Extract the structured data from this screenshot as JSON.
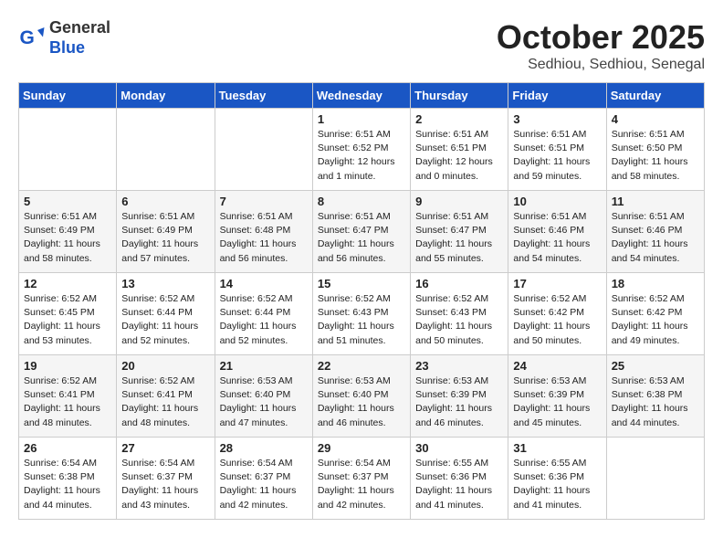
{
  "header": {
    "logo_general": "General",
    "logo_blue": "Blue",
    "month_title": "October 2025",
    "location": "Sedhiou, Sedhiou, Senegal"
  },
  "days_of_week": [
    "Sunday",
    "Monday",
    "Tuesday",
    "Wednesday",
    "Thursday",
    "Friday",
    "Saturday"
  ],
  "weeks": [
    [
      {
        "day": "",
        "info": ""
      },
      {
        "day": "",
        "info": ""
      },
      {
        "day": "",
        "info": ""
      },
      {
        "day": "1",
        "info": "Sunrise: 6:51 AM\nSunset: 6:52 PM\nDaylight: 12 hours\nand 1 minute."
      },
      {
        "day": "2",
        "info": "Sunrise: 6:51 AM\nSunset: 6:51 PM\nDaylight: 12 hours\nand 0 minutes."
      },
      {
        "day": "3",
        "info": "Sunrise: 6:51 AM\nSunset: 6:51 PM\nDaylight: 11 hours\nand 59 minutes."
      },
      {
        "day": "4",
        "info": "Sunrise: 6:51 AM\nSunset: 6:50 PM\nDaylight: 11 hours\nand 58 minutes."
      }
    ],
    [
      {
        "day": "5",
        "info": "Sunrise: 6:51 AM\nSunset: 6:49 PM\nDaylight: 11 hours\nand 58 minutes."
      },
      {
        "day": "6",
        "info": "Sunrise: 6:51 AM\nSunset: 6:49 PM\nDaylight: 11 hours\nand 57 minutes."
      },
      {
        "day": "7",
        "info": "Sunrise: 6:51 AM\nSunset: 6:48 PM\nDaylight: 11 hours\nand 56 minutes."
      },
      {
        "day": "8",
        "info": "Sunrise: 6:51 AM\nSunset: 6:47 PM\nDaylight: 11 hours\nand 56 minutes."
      },
      {
        "day": "9",
        "info": "Sunrise: 6:51 AM\nSunset: 6:47 PM\nDaylight: 11 hours\nand 55 minutes."
      },
      {
        "day": "10",
        "info": "Sunrise: 6:51 AM\nSunset: 6:46 PM\nDaylight: 11 hours\nand 54 minutes."
      },
      {
        "day": "11",
        "info": "Sunrise: 6:51 AM\nSunset: 6:46 PM\nDaylight: 11 hours\nand 54 minutes."
      }
    ],
    [
      {
        "day": "12",
        "info": "Sunrise: 6:52 AM\nSunset: 6:45 PM\nDaylight: 11 hours\nand 53 minutes."
      },
      {
        "day": "13",
        "info": "Sunrise: 6:52 AM\nSunset: 6:44 PM\nDaylight: 11 hours\nand 52 minutes."
      },
      {
        "day": "14",
        "info": "Sunrise: 6:52 AM\nSunset: 6:44 PM\nDaylight: 11 hours\nand 52 minutes."
      },
      {
        "day": "15",
        "info": "Sunrise: 6:52 AM\nSunset: 6:43 PM\nDaylight: 11 hours\nand 51 minutes."
      },
      {
        "day": "16",
        "info": "Sunrise: 6:52 AM\nSunset: 6:43 PM\nDaylight: 11 hours\nand 50 minutes."
      },
      {
        "day": "17",
        "info": "Sunrise: 6:52 AM\nSunset: 6:42 PM\nDaylight: 11 hours\nand 50 minutes."
      },
      {
        "day": "18",
        "info": "Sunrise: 6:52 AM\nSunset: 6:42 PM\nDaylight: 11 hours\nand 49 minutes."
      }
    ],
    [
      {
        "day": "19",
        "info": "Sunrise: 6:52 AM\nSunset: 6:41 PM\nDaylight: 11 hours\nand 48 minutes."
      },
      {
        "day": "20",
        "info": "Sunrise: 6:52 AM\nSunset: 6:41 PM\nDaylight: 11 hours\nand 48 minutes."
      },
      {
        "day": "21",
        "info": "Sunrise: 6:53 AM\nSunset: 6:40 PM\nDaylight: 11 hours\nand 47 minutes."
      },
      {
        "day": "22",
        "info": "Sunrise: 6:53 AM\nSunset: 6:40 PM\nDaylight: 11 hours\nand 46 minutes."
      },
      {
        "day": "23",
        "info": "Sunrise: 6:53 AM\nSunset: 6:39 PM\nDaylight: 11 hours\nand 46 minutes."
      },
      {
        "day": "24",
        "info": "Sunrise: 6:53 AM\nSunset: 6:39 PM\nDaylight: 11 hours\nand 45 minutes."
      },
      {
        "day": "25",
        "info": "Sunrise: 6:53 AM\nSunset: 6:38 PM\nDaylight: 11 hours\nand 44 minutes."
      }
    ],
    [
      {
        "day": "26",
        "info": "Sunrise: 6:54 AM\nSunset: 6:38 PM\nDaylight: 11 hours\nand 44 minutes."
      },
      {
        "day": "27",
        "info": "Sunrise: 6:54 AM\nSunset: 6:37 PM\nDaylight: 11 hours\nand 43 minutes."
      },
      {
        "day": "28",
        "info": "Sunrise: 6:54 AM\nSunset: 6:37 PM\nDaylight: 11 hours\nand 42 minutes."
      },
      {
        "day": "29",
        "info": "Sunrise: 6:54 AM\nSunset: 6:37 PM\nDaylight: 11 hours\nand 42 minutes."
      },
      {
        "day": "30",
        "info": "Sunrise: 6:55 AM\nSunset: 6:36 PM\nDaylight: 11 hours\nand 41 minutes."
      },
      {
        "day": "31",
        "info": "Sunrise: 6:55 AM\nSunset: 6:36 PM\nDaylight: 11 hours\nand 41 minutes."
      },
      {
        "day": "",
        "info": ""
      }
    ]
  ]
}
